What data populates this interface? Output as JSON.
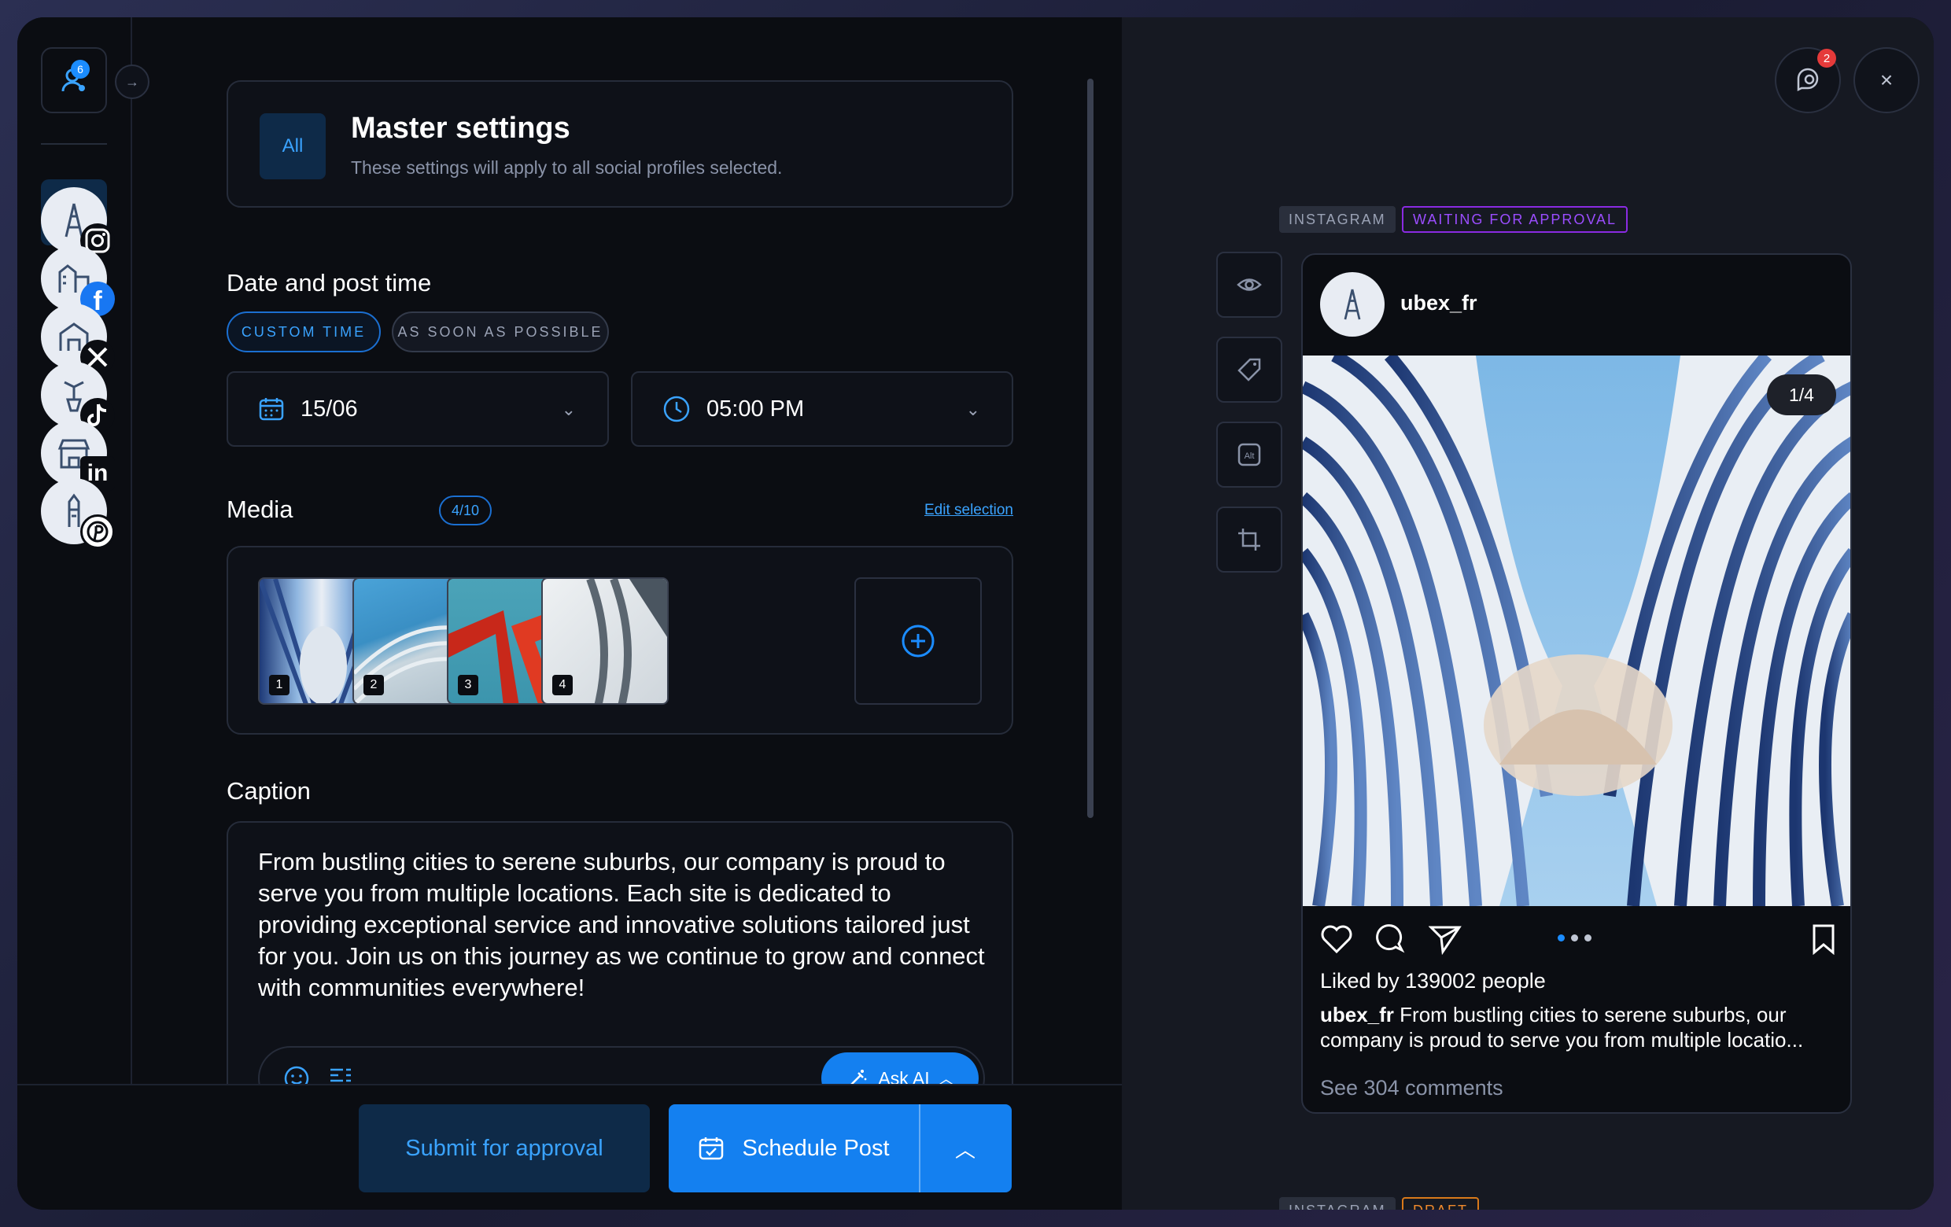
{
  "rail": {
    "logo_badge": "6",
    "all_label": "All"
  },
  "master": {
    "tag": "All",
    "title": "Master settings",
    "subtitle": "These settings will apply to all social profiles selected."
  },
  "schedule": {
    "title": "Date and post time",
    "option_custom": "CUSTOM TIME",
    "option_asap": "AS SOON AS POSSIBLE",
    "date_value": "15/06",
    "time_value": "05:00 PM"
  },
  "media": {
    "title": "Media",
    "count": "4/10",
    "edit_link": "Edit selection",
    "thumbs": [
      "1",
      "2",
      "3",
      "4"
    ]
  },
  "caption": {
    "title": "Caption",
    "text": "From bustling cities to serene suburbs, our company is proud to serve you from multiple locations. Each site is dedicated to providing exceptional service and innovative solutions tailored just for you. Join us on this journey as we continue to grow and connect with communities everywhere!",
    "ask_ai_label": "Ask AI"
  },
  "footer": {
    "submit_label": "Submit for approval",
    "schedule_label": "Schedule Post"
  },
  "preview": {
    "notif_badge": "2",
    "close_label": "×",
    "status1_network": "INSTAGRAM",
    "status1_state": "WAITING FOR APPROVAL",
    "status2_network": "INSTAGRAM",
    "status2_state": "DRAFT",
    "username": "ubex_fr",
    "counter": "1/4",
    "likes": "Liked by 139002 people",
    "caption_user": "ubex_fr",
    "caption_line1": "From bustling cities to serene suburbs, our",
    "caption_line2": "company is proud to serve you from multiple locatio...",
    "comments": "See 304 comments"
  },
  "colors": {
    "accent": "#1480f0",
    "accent_dark": "#0e2a48",
    "approval": "#8a2be2",
    "draft": "#d9791a"
  }
}
